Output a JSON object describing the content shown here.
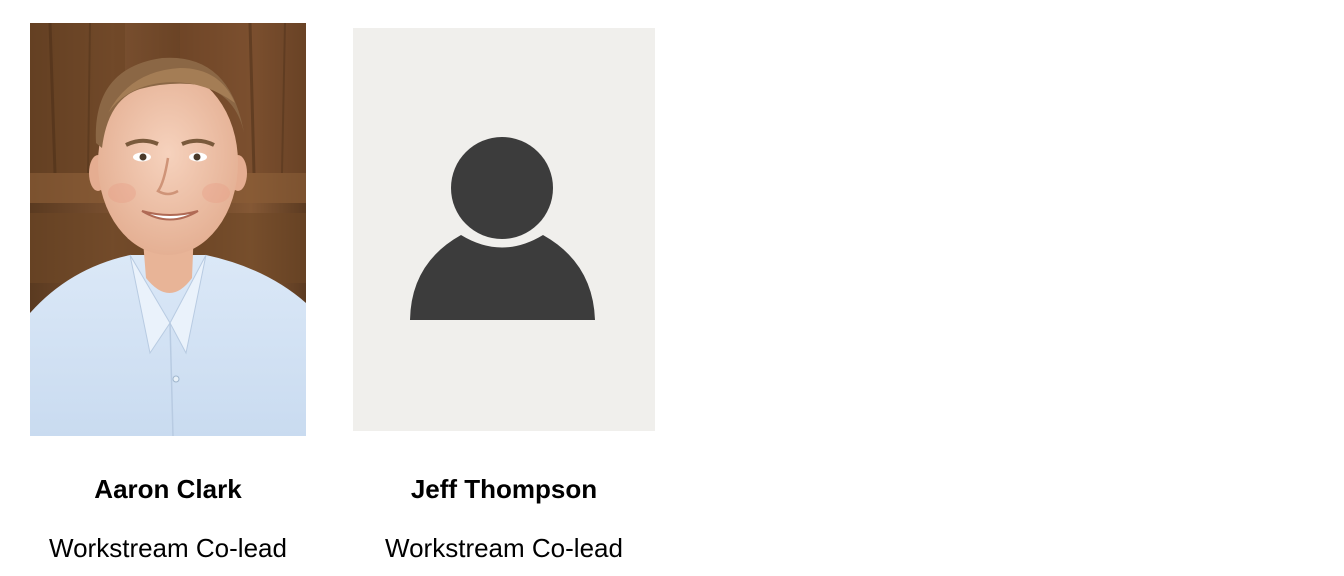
{
  "members": [
    {
      "name": "Aaron Clark",
      "role": "Workstream Co-lead",
      "photo_icon": "person-photo"
    },
    {
      "name": "Jeff Thompson",
      "role": "Workstream Co-lead",
      "photo_icon": "default-avatar-icon"
    }
  ],
  "colors": {
    "placeholder_bg": "#f0efec",
    "avatar_fill": "#3c3c3c"
  }
}
